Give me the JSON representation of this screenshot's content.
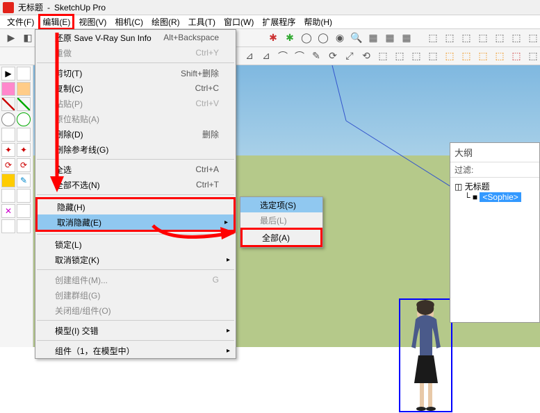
{
  "title": {
    "untitled": "无标题",
    "app": "SketchUp Pro"
  },
  "menubar": {
    "file": "文件(F)",
    "edit": "编辑(E)",
    "view": "视图(V)",
    "camera": "相机(C)",
    "draw": "绘图(R)",
    "tools": "工具(T)",
    "window": "窗口(W)",
    "extensions": "扩展程序",
    "help": "帮助(H)"
  },
  "edit_menu": {
    "restore_vray": "还原 Save V-Ray Sun Info",
    "restore_vray_sc": "Alt+Backspace",
    "redo": "重做",
    "redo_sc": "Ctrl+Y",
    "cut": "剪切(T)",
    "cut_sc": "Shift+删除",
    "copy": "复制(C)",
    "copy_sc": "Ctrl+C",
    "paste": "粘贴(P)",
    "paste_sc": "Ctrl+V",
    "paste_in_place": "原位粘贴(A)",
    "delete": "删除(D)",
    "delete_sc": "删除",
    "delete_guides": "删除参考线(G)",
    "select_all": "全选",
    "select_all_sc": "Ctrl+A",
    "select_none": "全部不选(N)",
    "select_none_sc": "Ctrl+T",
    "hide": "隐藏(H)",
    "unhide": "取消隐藏(E)",
    "lock": "锁定(L)",
    "unlock": "取消锁定(K)",
    "make_component": "创建组件(M)...",
    "make_component_sc": "G",
    "make_group": "创建群组(G)",
    "close_component": "关闭组/组件(O)",
    "intersect": "模型(I) 交错",
    "component_instance": "组件（1，在模型中）"
  },
  "unhide_submenu": {
    "selected": "选定项(S)",
    "last": "最后(L)",
    "all": "全部(A)"
  },
  "outliner": {
    "title": "大纲",
    "filter": "过滤",
    "root": "无标题",
    "item": "<Sophie>"
  }
}
